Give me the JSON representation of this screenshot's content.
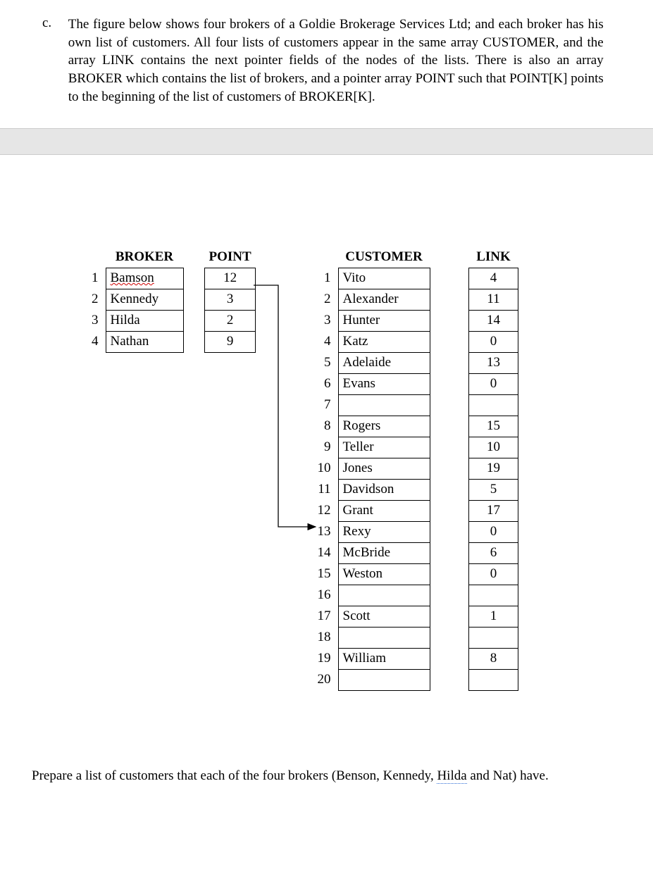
{
  "question": {
    "marker": "c.",
    "body_parts": [
      "The figure below shows four brokers of a Goldie Brokerage Services Ltd; and each broker has his own list of customers. All four lists of customers appear in the same array CUSTOMER, and the array LINK contains the next pointer fields of the nodes of the lists. There is also an array BROKER which contains the list of brokers, and a pointer array POINT such that POINT[K] points to the beginning of the list of customers of BROKER[K]."
    ]
  },
  "headers": {
    "broker": "BROKER",
    "point": "POINT",
    "customer": "CUSTOMER",
    "link": "LINK"
  },
  "broker_rows": [
    {
      "idx": "1",
      "name": "Bamson",
      "squiggle": true
    },
    {
      "idx": "2",
      "name": "Kennedy",
      "squiggle": false
    },
    {
      "idx": "3",
      "name": "Hilda",
      "squiggle": false
    },
    {
      "idx": "4",
      "name": "Nathan",
      "squiggle": false
    }
  ],
  "point_rows": [
    "12",
    "3",
    "2",
    "9"
  ],
  "customer_rows": [
    {
      "idx": "1",
      "name": "Vito",
      "link": "4"
    },
    {
      "idx": "2",
      "name": "Alexander",
      "link": "11"
    },
    {
      "idx": "3",
      "name": "Hunter",
      "link": "14"
    },
    {
      "idx": "4",
      "name": "Katz",
      "link": "0"
    },
    {
      "idx": "5",
      "name": "Adelaide",
      "link": "13"
    },
    {
      "idx": "6",
      "name": "Evans",
      "link": "0"
    },
    {
      "idx": "7",
      "name": "",
      "link": ""
    },
    {
      "idx": "8",
      "name": "Rogers",
      "link": "15"
    },
    {
      "idx": "9",
      "name": "Teller",
      "link": "10"
    },
    {
      "idx": "10",
      "name": "Jones",
      "link": "19"
    },
    {
      "idx": "11",
      "name": "Davidson",
      "link": "5"
    },
    {
      "idx": "12",
      "name": "Grant",
      "link": "17"
    },
    {
      "idx": "13",
      "name": "Rexy",
      "link": "0"
    },
    {
      "idx": "14",
      "name": "McBride",
      "link": "6"
    },
    {
      "idx": "15",
      "name": "Weston",
      "link": "0"
    },
    {
      "idx": "16",
      "name": "",
      "link": ""
    },
    {
      "idx": "17",
      "name": "Scott",
      "link": "1"
    },
    {
      "idx": "18",
      "name": "",
      "link": ""
    },
    {
      "idx": "19",
      "name": "William",
      "link": "8"
    },
    {
      "idx": "20",
      "name": "",
      "link": ""
    }
  ],
  "arrow_marker": "12",
  "bottom_question": {
    "prefix": "Prepare a list of customers that each of the four brokers (Benson, Kennedy, ",
    "hilda": "Hilda",
    "suffix": " and Nat) have."
  }
}
